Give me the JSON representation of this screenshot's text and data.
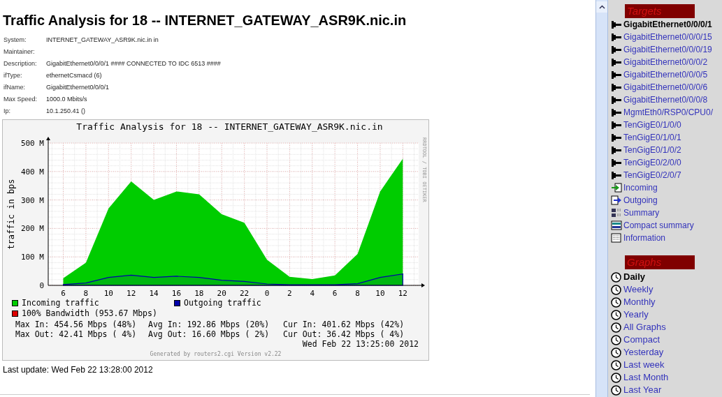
{
  "page_title": "Traffic Analysis for 18 -- INTERNET_GATEWAY_ASR9K.nic.in",
  "info": [
    {
      "label": "System:",
      "value": "INTERNET_GATEWAY_ASR9K.nic.in in"
    },
    {
      "label": "Maintainer:"
    },
    {
      "label": "Description:",
      "value": "GigabitEthernet0/0/0/1 #### CONNECTED TO IDC 6513 ####"
    },
    {
      "label": "ifType:",
      "value": "ethernetCsmacd (6)"
    },
    {
      "label": "ifName:",
      "value": "GigabitEthernet0/0/0/1"
    },
    {
      "label": "Max Speed:",
      "value": "1000.0 Mbits/s"
    },
    {
      "label": "Ip:",
      "value": "10.1.250.41 ()"
    }
  ],
  "graph": {
    "title": "Traffic Analysis for 18 -- INTERNET_GATEWAY_ASR9K.nic.in",
    "side_text": "RRDTOOL / TOBI OETIKER",
    "chart_data": {
      "type": "area",
      "ylabel": "traffic in bps",
      "ylim": [
        0,
        500
      ],
      "grid": true,
      "categories": [
        "6",
        "8",
        "10",
        "12",
        "14",
        "16",
        "18",
        "20",
        "22",
        "0",
        "2",
        "4",
        "6",
        "8",
        "10",
        "12"
      ],
      "series": [
        {
          "name": "Incoming traffic",
          "color": "#00cc00",
          "values": [
            25,
            80,
            270,
            365,
            300,
            330,
            320,
            250,
            220,
            90,
            30,
            22,
            35,
            110,
            330,
            445
          ]
        },
        {
          "name": "Outgoing traffic",
          "color": "#0000aa",
          "values": [
            3,
            8,
            28,
            36,
            28,
            32,
            28,
            18,
            14,
            5,
            2,
            2,
            2,
            6,
            28,
            40
          ]
        }
      ],
      "yticks": [
        {
          "value": 0,
          "label": "0"
        },
        {
          "value": 100,
          "label": "100 M"
        },
        {
          "value": 200,
          "label": "200 M"
        },
        {
          "value": 300,
          "label": "300 M"
        },
        {
          "value": 400,
          "label": "400 M"
        },
        {
          "value": 500,
          "label": "500 M"
        }
      ]
    },
    "legend_extra": [
      {
        "label": "100% Bandwidth (953.67 Mbps)",
        "color": "#dd0000"
      }
    ],
    "stats": [
      [
        "Max In: 454.56 Mbps (48%)",
        "Avg In: 192.86 Mbps (20%)",
        "Cur In: 401.62 Mbps (42%)"
      ],
      [
        "Max Out: 42.41 Mbps ( 4%)",
        "Avg Out: 16.60 Mbps ( 2%)",
        "Cur Out: 36.42 Mbps ( 4%)"
      ]
    ],
    "date": "Wed Feb 22 13:25:00 2012",
    "generated": "Generated by routers2.cgi Version v2.22"
  },
  "last_update": "Last update: Wed Feb 22 13:28:00 2012",
  "sidebar": {
    "targets_heading": "Targets",
    "targets": [
      {
        "label": "GigabitEthernet0/0/0/1",
        "kind": "port",
        "selected": true
      },
      {
        "label": "GigabitEthernet0/0/0/15",
        "kind": "port",
        "selected": false
      },
      {
        "label": "GigabitEthernet0/0/0/19",
        "kind": "port",
        "selected": false
      },
      {
        "label": "GigabitEthernet0/0/0/2",
        "kind": "port",
        "selected": false
      },
      {
        "label": "GigabitEthernet0/0/0/5",
        "kind": "port",
        "selected": false
      },
      {
        "label": "GigabitEthernet0/0/0/6",
        "kind": "port",
        "selected": false
      },
      {
        "label": "GigabitEthernet0/0/0/8",
        "kind": "port",
        "selected": false
      },
      {
        "label": "MgmtEth0/RSP0/CPU0/",
        "kind": "port",
        "selected": false
      },
      {
        "label": "TenGigE0/1/0/0",
        "kind": "port",
        "selected": false
      },
      {
        "label": "TenGigE0/1/0/1",
        "kind": "port",
        "selected": false
      },
      {
        "label": "TenGigE0/1/0/2",
        "kind": "port",
        "selected": false
      },
      {
        "label": "TenGigE0/2/0/0",
        "kind": "port",
        "selected": false
      },
      {
        "label": "TenGigE0/2/0/7",
        "kind": "port",
        "selected": false
      },
      {
        "label": "Incoming",
        "kind": "incoming",
        "selected": false
      },
      {
        "label": "Outgoing",
        "kind": "outgoing",
        "selected": false
      },
      {
        "label": "Summary",
        "kind": "summary",
        "selected": false
      },
      {
        "label": "Compact summary",
        "kind": "compact",
        "selected": false
      },
      {
        "label": "Information",
        "kind": "info",
        "selected": false
      }
    ],
    "graphs_heading": "Graphs",
    "graphs": [
      {
        "label": "Daily",
        "selected": true
      },
      {
        "label": "Weekly",
        "selected": false
      },
      {
        "label": "Monthly",
        "selected": false
      },
      {
        "label": "Yearly",
        "selected": false
      },
      {
        "label": "All Graphs",
        "selected": false
      },
      {
        "label": "Compact",
        "selected": false
      },
      {
        "label": "Yesterday",
        "selected": false
      },
      {
        "label": "Last week",
        "selected": false
      },
      {
        "label": "Last Month",
        "selected": false
      },
      {
        "label": "Last Year",
        "selected": false
      }
    ]
  }
}
